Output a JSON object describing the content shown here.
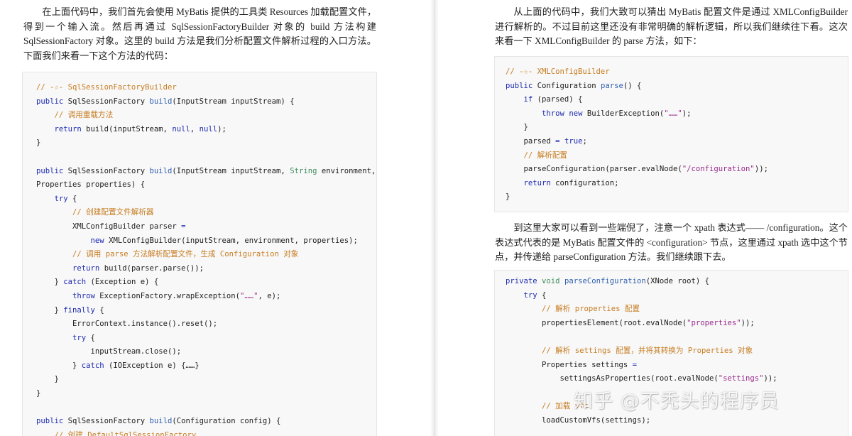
{
  "left_page": {
    "paragraph": "在上面代码中，我们首先会使用 MyBatis 提供的工具类 Resources 加载配置文件，得到一个输入流。然后再通过 SqlSessionFactoryBuilder 对象的 build 方法构建 SqlSessionFactory 对象。这里的 build 方法是我们分析配置文件解析过程的入口方法。下面我们来看一下这个方法的代码：",
    "code_lines": [
      [
        {
          "t": "// -☆- SqlSessionFactoryBuilder",
          "c": "com"
        }
      ],
      [
        {
          "t": "public",
          "c": "kw"
        },
        {
          "t": " SqlSessionFactory "
        },
        {
          "t": "build",
          "c": "fn"
        },
        {
          "t": "(InputStream inputStream) {"
        }
      ],
      [
        {
          "t": "    "
        },
        {
          "t": "// 调用重载方法",
          "c": "com"
        }
      ],
      [
        {
          "t": "    "
        },
        {
          "t": "return",
          "c": "kw"
        },
        {
          "t": " build(inputStream, "
        },
        {
          "t": "null",
          "c": "kw"
        },
        {
          "t": ", "
        },
        {
          "t": "null",
          "c": "kw"
        },
        {
          "t": ");"
        }
      ],
      [
        {
          "t": "}"
        }
      ],
      [
        {
          "t": ""
        }
      ],
      [
        {
          "t": "public",
          "c": "kw"
        },
        {
          "t": " SqlSessionFactory "
        },
        {
          "t": "build",
          "c": "fn"
        },
        {
          "t": "(InputStream inputStream, "
        },
        {
          "t": "String",
          "c": "ty"
        },
        {
          "t": " environment,"
        }
      ],
      [
        {
          "t": "Properties properties) {"
        }
      ],
      [
        {
          "t": "    "
        },
        {
          "t": "try",
          "c": "kw"
        },
        {
          "t": " {"
        }
      ],
      [
        {
          "t": "        "
        },
        {
          "t": "// 创建配置文件解析器",
          "c": "com"
        }
      ],
      [
        {
          "t": "        XMLConfigBuilder parser "
        },
        {
          "t": "=",
          "c": "kw"
        }
      ],
      [
        {
          "t": "            "
        },
        {
          "t": "new",
          "c": "kw"
        },
        {
          "t": " XMLConfigBuilder(inputStream, environment, properties);"
        }
      ],
      [
        {
          "t": "        "
        },
        {
          "t": "// 调用 parse 方法解析配置文件，生成 Configuration 对象",
          "c": "com"
        }
      ],
      [
        {
          "t": "        "
        },
        {
          "t": "return",
          "c": "kw"
        },
        {
          "t": " build(parser.parse());"
        }
      ],
      [
        {
          "t": "    } "
        },
        {
          "t": "catch",
          "c": "kw"
        },
        {
          "t": " (Exception e) {"
        }
      ],
      [
        {
          "t": "        "
        },
        {
          "t": "throw",
          "c": "kw"
        },
        {
          "t": " ExceptionFactory.wrapException("
        },
        {
          "t": "\"……\"",
          "c": "str"
        },
        {
          "t": ", e);"
        }
      ],
      [
        {
          "t": "    } "
        },
        {
          "t": "finally",
          "c": "kw"
        },
        {
          "t": " {"
        }
      ],
      [
        {
          "t": "        ErrorContext.instance().reset();"
        }
      ],
      [
        {
          "t": "        "
        },
        {
          "t": "try",
          "c": "kw"
        },
        {
          "t": " {"
        }
      ],
      [
        {
          "t": "            inputStream.close();"
        }
      ],
      [
        {
          "t": "        } "
        },
        {
          "t": "catch",
          "c": "kw"
        },
        {
          "t": " (IOException e) {……}"
        }
      ],
      [
        {
          "t": "    }"
        }
      ],
      [
        {
          "t": "}"
        }
      ],
      [
        {
          "t": ""
        }
      ],
      [
        {
          "t": "public",
          "c": "kw"
        },
        {
          "t": " SqlSessionFactory "
        },
        {
          "t": "build",
          "c": "fn"
        },
        {
          "t": "(Configuration config) {"
        }
      ],
      [
        {
          "t": "    "
        },
        {
          "t": "// 创建 DefaultSqlSessionFactory",
          "c": "com"
        }
      ]
    ]
  },
  "right_page": {
    "paragraph_1": "从上面的代码中，我们大致可以猜出 MyBatis 配置文件是通过 XMLConfigBuilder 进行解析的。不过目前这里还没有非常明确的解析逻辑，所以我们继续往下看。这次来看一下 XMLConfigBuilder 的 parse 方法，如下：",
    "code_1_lines": [
      [
        {
          "t": "// -☆- XMLConfigBuilder",
          "c": "com"
        }
      ],
      [
        {
          "t": "public",
          "c": "kw"
        },
        {
          "t": " Configuration "
        },
        {
          "t": "parse",
          "c": "fn"
        },
        {
          "t": "() {"
        }
      ],
      [
        {
          "t": "    "
        },
        {
          "t": "if",
          "c": "kw"
        },
        {
          "t": " (parsed) {"
        }
      ],
      [
        {
          "t": "        "
        },
        {
          "t": "throw",
          "c": "kw"
        },
        {
          "t": " "
        },
        {
          "t": "new",
          "c": "kw"
        },
        {
          "t": " BuilderException("
        },
        {
          "t": "\"……\"",
          "c": "str"
        },
        {
          "t": ");"
        }
      ],
      [
        {
          "t": "    }"
        }
      ],
      [
        {
          "t": "    parsed "
        },
        {
          "t": "=",
          "c": "kw"
        },
        {
          "t": " "
        },
        {
          "t": "true",
          "c": "kw"
        },
        {
          "t": ";"
        }
      ],
      [
        {
          "t": "    "
        },
        {
          "t": "// 解析配置",
          "c": "com"
        }
      ],
      [
        {
          "t": "    parseConfiguration(parser.evalNode("
        },
        {
          "t": "\"/configuration\"",
          "c": "str"
        },
        {
          "t": "));"
        }
      ],
      [
        {
          "t": "    "
        },
        {
          "t": "return",
          "c": "kw"
        },
        {
          "t": " configuration;"
        }
      ],
      [
        {
          "t": "}"
        }
      ]
    ],
    "paragraph_2": "到这里大家可以看到一些端倪了，注意一个 xpath 表达式—— /configuration。这个表达式代表的是 MyBatis 配置文件的 <configuration> 节点，这里通过 xpath 选中这个节点，并传递给 parseConfiguration 方法。我们继续跟下去。",
    "code_2_lines": [
      [
        {
          "t": "private",
          "c": "kw"
        },
        {
          "t": " "
        },
        {
          "t": "void",
          "c": "ty"
        },
        {
          "t": " "
        },
        {
          "t": "parseConfiguration",
          "c": "fn"
        },
        {
          "t": "(XNode root) {"
        }
      ],
      [
        {
          "t": "    "
        },
        {
          "t": "try",
          "c": "kw"
        },
        {
          "t": " {"
        }
      ],
      [
        {
          "t": "        "
        },
        {
          "t": "// 解析 properties 配置",
          "c": "com"
        }
      ],
      [
        {
          "t": "        propertiesElement(root.evalNode("
        },
        {
          "t": "\"properties\"",
          "c": "str"
        },
        {
          "t": "));"
        }
      ],
      [
        {
          "t": ""
        }
      ],
      [
        {
          "t": "        "
        },
        {
          "t": "// 解析 settings 配置，并将其转换为 Properties 对象",
          "c": "com"
        }
      ],
      [
        {
          "t": "        Properties settings "
        },
        {
          "t": "=",
          "c": "kw"
        }
      ],
      [
        {
          "t": "            settingsAsProperties(root.evalNode("
        },
        {
          "t": "\"settings\"",
          "c": "str"
        },
        {
          "t": "));"
        }
      ],
      [
        {
          "t": ""
        }
      ],
      [
        {
          "t": "        "
        },
        {
          "t": "// 加载 vfs",
          "c": "com"
        }
      ],
      [
        {
          "t": "        loadCustomVfs(settings);"
        }
      ]
    ]
  },
  "watermark": "知乎 @不秃头的程序员"
}
